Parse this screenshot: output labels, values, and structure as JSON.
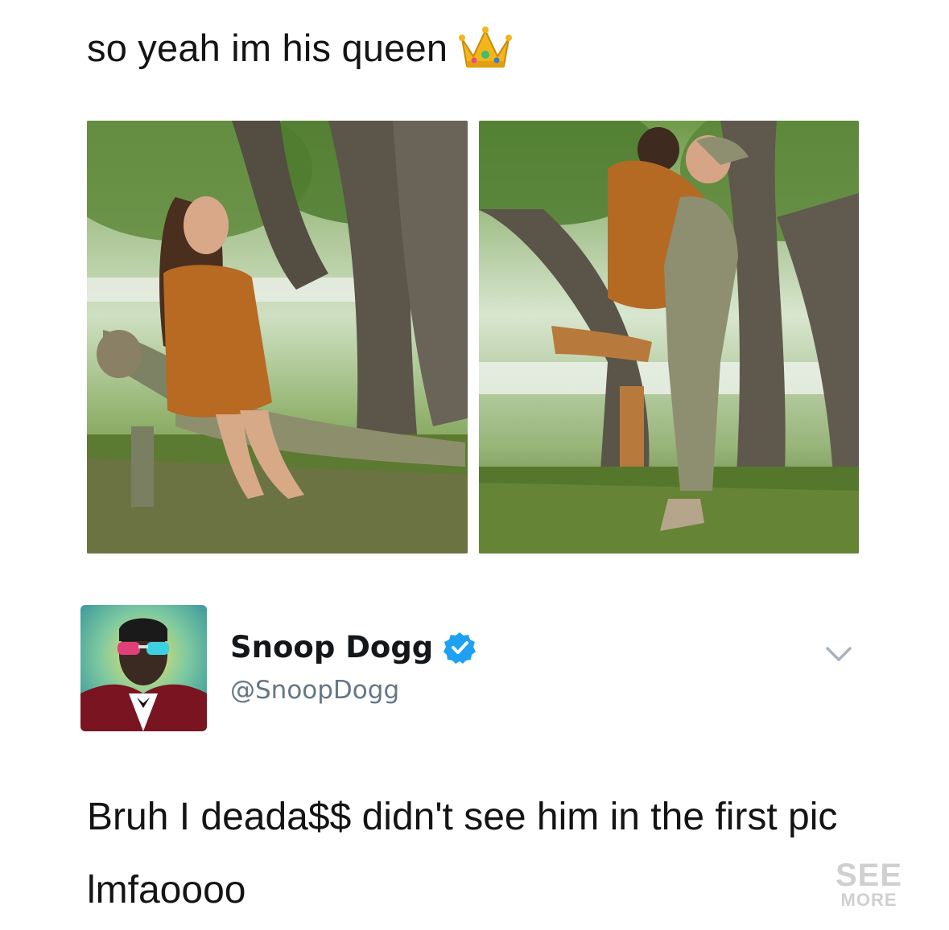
{
  "post": {
    "caption": "so yeah im his queen",
    "caption_emoji": "crown-emoji"
  },
  "photos": {
    "left_description_icon": "couple-photo-left",
    "right_description_icon": "couple-photo-right"
  },
  "tweet": {
    "display_name": "Snoop Dogg",
    "handle": "@SnoopDogg",
    "verified": true,
    "text": "Bruh I deada$$ didn't see him in the first pic lmfaoooo",
    "menu_icon": "chevron-down-icon"
  },
  "watermark": {
    "line1": "SEE",
    "line2": "MORE"
  },
  "colors": {
    "verified_blue": "#1da1f2",
    "handle_gray": "#657786",
    "text_dark": "#141414"
  }
}
